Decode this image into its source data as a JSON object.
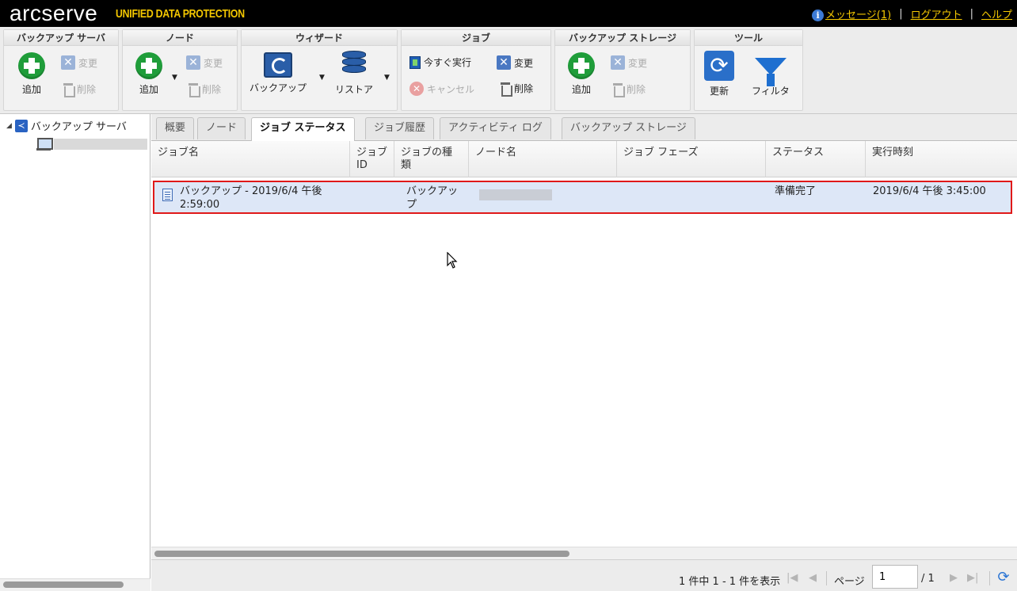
{
  "header": {
    "logo": "arcserve",
    "product": "UNIFIED DATA PROTECTION",
    "messages": "メッセージ(1)",
    "logout": "ログアウト",
    "help": "ヘルプ",
    "separator": "|"
  },
  "ribbon": {
    "backup_server": {
      "title": "バックアップ サーバ",
      "add": "追加",
      "edit": "変更",
      "delete": "削除"
    },
    "node": {
      "title": "ノード",
      "add": "追加",
      "edit": "変更",
      "delete": "削除"
    },
    "wizard": {
      "title": "ウィザード",
      "backup": "バックアップ",
      "restore": "リストア"
    },
    "job": {
      "title": "ジョブ",
      "run_now": "今すぐ実行",
      "edit": "変更",
      "cancel": "キャンセル",
      "delete": "削除"
    },
    "backup_storage": {
      "title": "バックアップ ストレージ",
      "add": "追加",
      "edit": "変更",
      "delete": "削除"
    },
    "tools": {
      "title": "ツール",
      "refresh": "更新",
      "filter": "フィルタ"
    }
  },
  "tree": {
    "root": "バックアップ サーバ"
  },
  "tabs": [
    {
      "label": "概要",
      "active": false
    },
    {
      "label": "ノード",
      "active": false
    },
    {
      "label": "ジョブ ステータス",
      "active": true
    },
    {
      "label": "ジョブ履歴",
      "active": false
    },
    {
      "label": "アクティビティ ログ",
      "active": false
    },
    {
      "label": "バックアップ ストレージ",
      "active": false
    }
  ],
  "grid": {
    "columns": {
      "job_name": "ジョブ名",
      "job_id_1": "ジョブ",
      "job_id_2": "ID",
      "job_type_1": "ジョブの種",
      "job_type_2": "類",
      "node_name": "ノード名",
      "job_phase": "ジョブ フェーズ",
      "status": "ステータス",
      "run_time": "実行時刻"
    },
    "rows": [
      {
        "job_name_1": "バックアップ - 2019/6/4 午後",
        "job_name_2": "2:59:00",
        "job_id": "",
        "job_type_1": "バックアッ",
        "job_type_2": "プ",
        "job_phase": "",
        "status": "準備完了",
        "run_time": "2019/6/4 午後 3:45:00"
      }
    ]
  },
  "pager": {
    "summary": "1 件中 1 - 1 件を表示",
    "page_label": "ページ",
    "page_value": "1",
    "total": "/ 1"
  },
  "colors": {
    "header_bg": "#000000",
    "accent_yellow": "#f5c800",
    "selected_row": "#dde7f7",
    "highlight_border": "#e01919",
    "add_green": "#1f9d3a"
  }
}
